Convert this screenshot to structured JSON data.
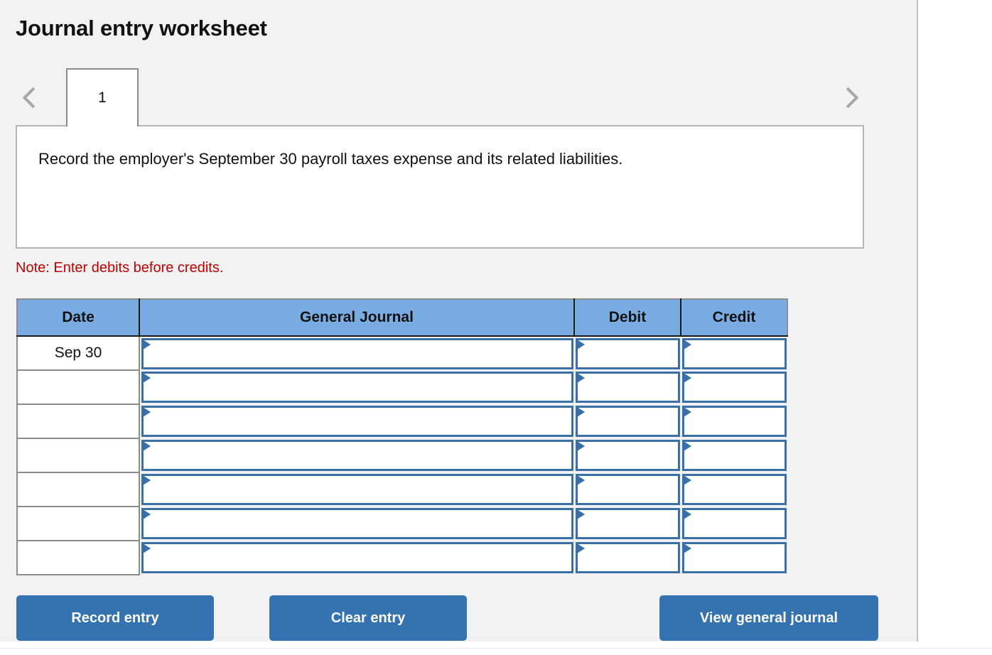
{
  "header": {
    "title": "Journal entry worksheet"
  },
  "tabs": {
    "prev_arrow": "chevron-left-icon",
    "next_arrow": "chevron-right-icon",
    "items": [
      {
        "label": "1",
        "active": true
      }
    ]
  },
  "prompt": {
    "text": "Record the employer's September 30 payroll taxes expense and its related liabilities."
  },
  "note": {
    "text": "Note: Enter debits before credits."
  },
  "table": {
    "columns": [
      "Date",
      "General Journal",
      "Debit",
      "Credit"
    ],
    "rows": [
      {
        "date": "Sep 30",
        "general_journal": "",
        "debit": "",
        "credit": ""
      },
      {
        "date": "",
        "general_journal": "",
        "debit": "",
        "credit": ""
      },
      {
        "date": "",
        "general_journal": "",
        "debit": "",
        "credit": ""
      },
      {
        "date": "",
        "general_journal": "",
        "debit": "",
        "credit": ""
      },
      {
        "date": "",
        "general_journal": "",
        "debit": "",
        "credit": ""
      },
      {
        "date": "",
        "general_journal": "",
        "debit": "",
        "credit": ""
      },
      {
        "date": "",
        "general_journal": "",
        "debit": "",
        "credit": ""
      }
    ]
  },
  "buttons": {
    "record": "Record entry",
    "clear": "Clear entry",
    "view": "View general journal"
  },
  "colors": {
    "header_blue": "#7aace4",
    "input_border_blue": "#3a6fa8",
    "button_blue": "#3572b0",
    "note_red": "#c00000",
    "panel_grey": "#f2f2f2"
  }
}
